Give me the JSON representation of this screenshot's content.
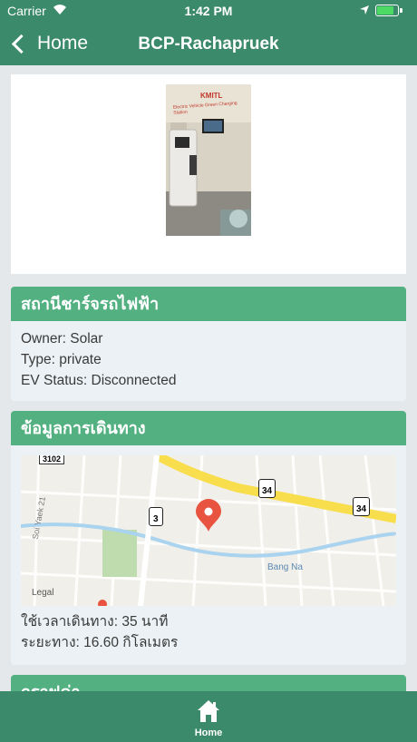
{
  "status_bar": {
    "carrier": "Carrier",
    "time": "1:42 PM",
    "battery_level": 0.8
  },
  "nav": {
    "back_label": "Home",
    "title": "BCP-Rachapruek"
  },
  "station": {
    "photo_sign_logo": "KMITL",
    "photo_sign_text": "Electric Vehicle Green Charging Station"
  },
  "info_card": {
    "title": "สถานีชาร์จรถไฟฟ้า",
    "owner": "Owner: Solar",
    "type": "Type: private",
    "ev_status": "EV Status: Disconnected"
  },
  "travel_card": {
    "title": "ข้อมูลการเดินทาง",
    "map": {
      "road_shields": [
        "3102",
        "34",
        "3",
        "34"
      ],
      "place_labels": [
        "Bang Na",
        "Soi Yaek 21",
        "Legal"
      ],
      "pin_color": "#e8543f"
    },
    "travel_time": "ใช้เวลาเดินทาง: 35 นาที",
    "distance": "ระยะทาง: 16.60 กิโลเมตร"
  },
  "next_card": {
    "title": "กราฟค่า"
  },
  "tab_bar": {
    "home_label": "Home",
    "home_icon": "house-icon"
  },
  "colors": {
    "header": "#3c8a6c",
    "card_header": "#52b081",
    "card_body": "#ebf1f4",
    "page_bg": "#e5e8ea"
  }
}
